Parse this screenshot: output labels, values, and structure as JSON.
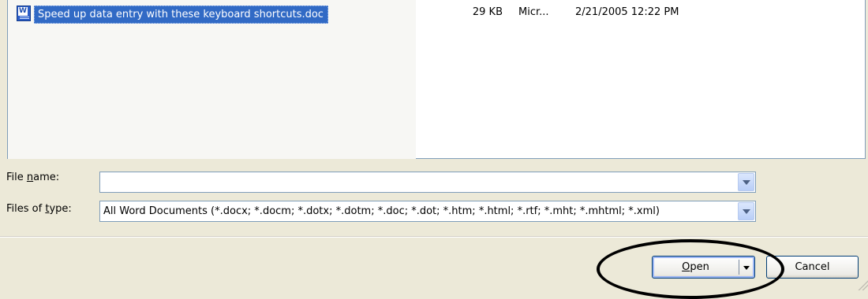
{
  "file_list": {
    "files": [
      {
        "name": "Speed up data entry with these keyboard shortcuts.doc",
        "size": "29 KB",
        "type": "Micr...",
        "date": "2/21/2005 12:22 PM",
        "icon": "word-document-icon",
        "selected": true
      }
    ]
  },
  "form": {
    "file_name": {
      "label_pre": "File ",
      "label_accel": "n",
      "label_post": "ame:",
      "value": ""
    },
    "file_type": {
      "label_pre": "Files of ",
      "label_accel": "t",
      "label_post": "ype:",
      "value": "All Word Documents (*.docx; *.docm; *.dotx; *.dotm; *.doc; *.dot; *.htm; *.html; *.rtf; *.mht; *.mhtml; *.xml)"
    }
  },
  "buttons": {
    "open_accel": "O",
    "open_rest": "pen",
    "cancel": "Cancel"
  },
  "colors": {
    "selection": "#316ac5",
    "dialog_bg": "#ece9d8",
    "highlight_ring": "#000000"
  }
}
